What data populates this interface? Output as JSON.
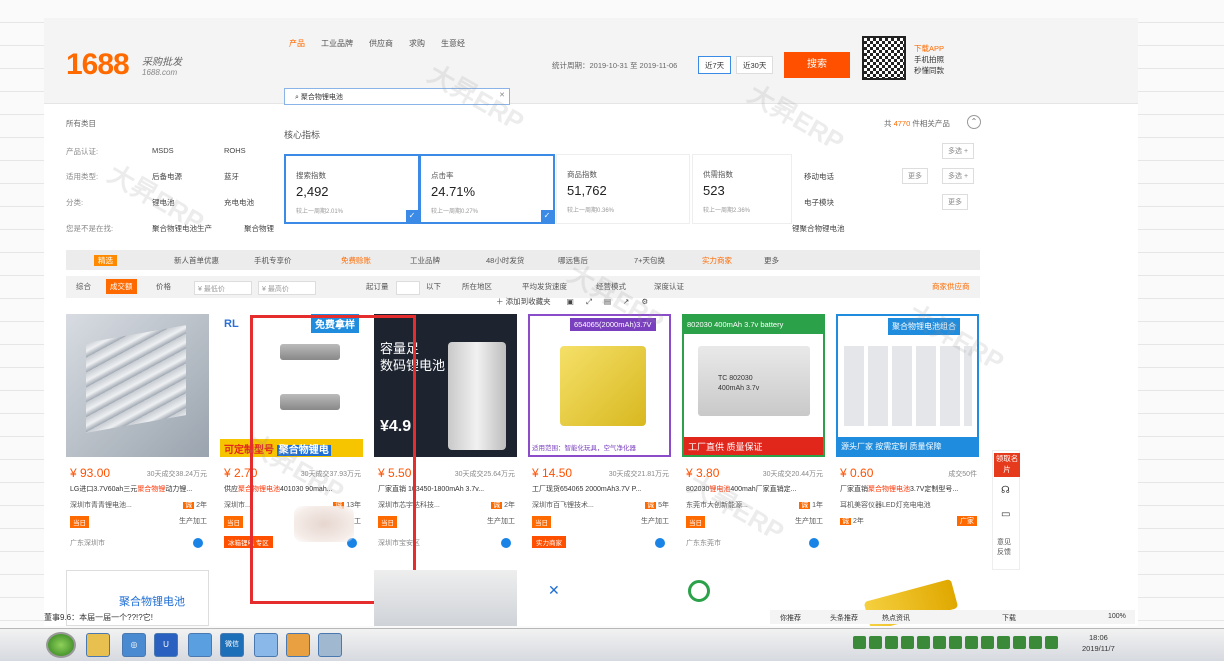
{
  "brand": {
    "logo": "1688",
    "slogan_cn": "采购批发",
    "slogan_url": "1688.com"
  },
  "search": {
    "tabs": [
      "产品",
      "工业品牌",
      "供应商",
      "求购",
      "生意经"
    ],
    "query": "聚合物锂电池",
    "hint": "核心指标",
    "stat_period": "统计周期：2019-10-31 至 2019-11-06",
    "range_7": "近7天",
    "range_30": "近30天",
    "button": "搜索"
  },
  "app_promo": {
    "line1": "下载APP",
    "line2": "手机拍照",
    "line3": "秒懂同款"
  },
  "summary": {
    "all": "所有类目",
    "prefix": "共",
    "count": "4770",
    "suffix": "件相关产品"
  },
  "filters": [
    {
      "label": "产品认证:",
      "values": [
        "MSDS",
        "ROHS"
      ],
      "more": "多选 +"
    },
    {
      "label": "适用类型:",
      "values": [
        "后备电源",
        "蓝牙"
      ],
      "more": "多选 +"
    },
    {
      "label": "分类:",
      "values": [
        "锂电池",
        "充电电池"
      ],
      "more": "更多"
    },
    {
      "label": "您是不是在找:",
      "values": [
        "聚合物锂电池生产",
        "聚合物锂"
      ],
      "more": ""
    }
  ],
  "right_filters": {
    "mobile": "移动电话",
    "more1": "更多",
    "multi": "多选 +",
    "module": "电子模块",
    "more2": "更多",
    "link": "锂聚合物锂电池"
  },
  "metrics": [
    {
      "label": "搜索指数",
      "value": "2,492",
      "sub": "较上一周期2.01%",
      "selected": true
    },
    {
      "label": "点击率",
      "value": "24.71%",
      "sub": "较上一周期0.27%",
      "selected": true
    },
    {
      "label": "商品指数",
      "value": "51,762",
      "sub": "较上一周期0.36%",
      "selected": false
    },
    {
      "label": "供需指数",
      "value": "523",
      "sub": "较上一周期2.36%",
      "selected": false
    }
  ],
  "checkbar": [
    "新人首单优惠",
    "手机专享价",
    "免费赊账",
    "工业品牌",
    "48小时发货",
    "哪远售后",
    "7+天包换",
    "实力商家",
    "更多"
  ],
  "sortbar": {
    "all": "综合",
    "sales": "成交额",
    "price": "价格",
    "min": "¥ 最低价",
    "max": "¥ 最高价",
    "qty": "起订量",
    "below": "以下",
    "area": "所在地区",
    "delivery": "平均发货速度",
    "mode": "经营模式",
    "cert": "深度认证",
    "supplier": "商家供应商"
  },
  "toolbar": {
    "add": "添加到收藏夹"
  },
  "products": [
    {
      "price": "¥ 93.00",
      "sold": "30天成交38.24万元",
      "title_pre": "LG进口3.7V60ah三元",
      "title_hl": "聚合物锂",
      "title_post": "动力锂...",
      "seller": "深圳市青青锂电池...",
      "years": "2年",
      "tag": "当日",
      "mode": "生产加工",
      "loc": "广东深圳市"
    },
    {
      "price": "¥ 2.70",
      "sold": "30天成交37.93万元",
      "title_pre": "供应",
      "title_hl": "聚合物锂电池",
      "title_post": "401030 90mah...",
      "seller": "深圳市...",
      "years": "13年",
      "tag": "当日",
      "mode": "生产加工",
      "loc": "冰箱锂电 专区"
    },
    {
      "price": "¥ 5.50",
      "sold": "30天成交25.64万元",
      "title_pre": "厂家直销 103450-1800mAh 3.7v...",
      "title_hl": "",
      "title_post": "",
      "seller": "深圳市芯宇达科技...",
      "years": "2年",
      "tag": "当日",
      "mode": "生产加工",
      "loc": "深圳市宝安区"
    },
    {
      "price": "¥ 14.50",
      "sold": "30天成交21.81万元",
      "title_pre": "工厂现货654065 2000mAh3.7V P...",
      "title_hl": "",
      "title_post": "",
      "seller": "深圳市百飞锂技术...",
      "years": "5年",
      "tag": "当日",
      "mode": "生产加工",
      "loc": "实力商家"
    },
    {
      "price": "¥ 3.80",
      "sold": "30天成交20.44万元",
      "title_pre": "802030",
      "title_hl": "锂电池",
      "title_post": "400mah厂家直销定...",
      "seller": "东莞市大创新能源...",
      "years": "1年",
      "tag": "当日",
      "mode": "生产加工",
      "loc": "广东东莞市"
    },
    {
      "price": "¥ 0.60",
      "sold": "成交50件",
      "title_pre": "厂家直销",
      "title_hl": "聚合物锂电池",
      "title_post": "3.7V定制型号...",
      "seller": "耳机美容仪器LED灯充电电池",
      "years": "2年",
      "tag": "",
      "mode": "广家",
      "loc": ""
    }
  ],
  "banners": {
    "p2_top": "免费拿样",
    "p2_bottom_a": "可定制型号",
    "p2_bottom_b": "聚合物锂电",
    "p3_a": "容量足",
    "p3_b": "数码锂电池",
    "p3_price": "¥4.9",
    "p4_top": "654065(2000mAh)3.7V",
    "p4_bottom": "适用范围：智能化玩具，空气净化器",
    "p5_top": "802030 400mAh 3.7v battery",
    "p5_cell": "TC 802030",
    "p5_cell2": "400mAh 3.7v",
    "p5_bottom": "工厂直供 质量保证",
    "p6_top": "聚合物锂电池组合",
    "p6_bottom": "源头厂家 按需定制 质量保障",
    "p7": "聚合物锂电池"
  },
  "side": {
    "badge": "领取名片",
    "feedback": "意见反馈"
  },
  "status": {
    "items": [
      "你推荐",
      "头条推荐",
      "热点资讯",
      "下载",
      "100%"
    ]
  },
  "news": "董事9.6：本届一届一个??!?它!",
  "taskbar": {
    "time": "18:06",
    "date": "2019/11/7",
    "icon_text": "微信"
  },
  "watermark": "大昇ERP"
}
